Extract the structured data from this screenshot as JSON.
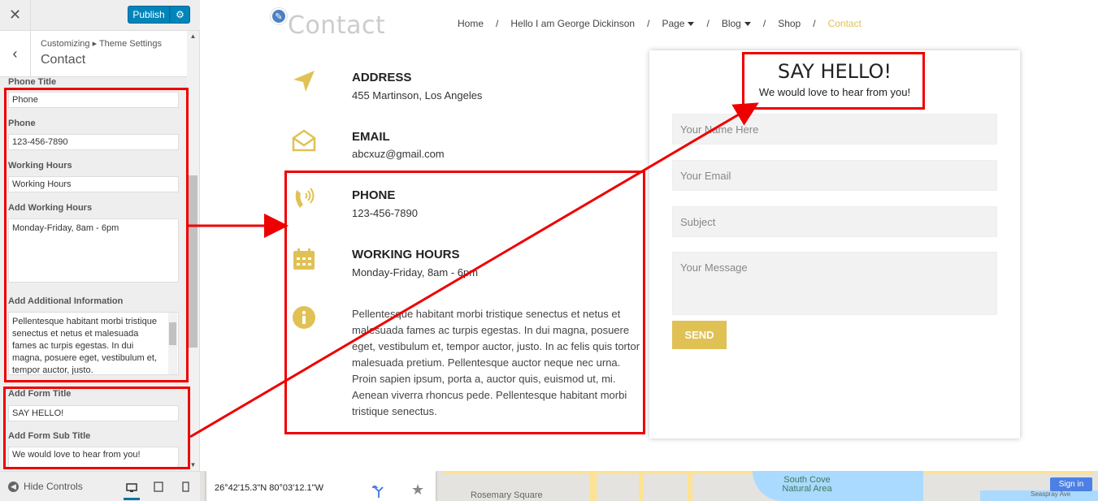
{
  "sidebar": {
    "close_label": "✕",
    "publish_label": "Publish",
    "gear_label": "⚙",
    "back_label": "‹",
    "breadcrumb": "Customizing ▸ Theme Settings",
    "section_title": "Contact",
    "fields": {
      "phone_title_label": "Phone Title",
      "phone_title_value": "Phone",
      "phone_label": "Phone",
      "phone_value": "123-456-7890",
      "working_hours_label": "Working Hours",
      "working_hours_value": "Working Hours",
      "add_working_hours_label": "Add Working Hours",
      "add_working_hours_value": "Monday-Friday, 8am - 6pm",
      "additional_info_label": "Add Additional Information",
      "additional_info_value": "Pellentesque habitant morbi tristique senectus et netus et malesuada fames ac turpis egestas. In dui magna, posuere eget, vestibulum et, tempor auctor, justo.",
      "form_title_label": "Add Form Title",
      "form_title_value": "SAY HELLO!",
      "form_subtitle_label": "Add Form Sub Title",
      "form_subtitle_value": "We would love to hear from you!"
    },
    "footer": {
      "hide_controls": "Hide Controls"
    }
  },
  "preview": {
    "page_title": "Contact",
    "nav": {
      "home": "Home",
      "about": "Hello I am George Dickinson",
      "page": "Page",
      "blog": "Blog",
      "shop": "Shop",
      "contact": "Contact",
      "separator": "/"
    },
    "info": {
      "address_head": "ADDRESS",
      "address_val": "455 Martinson, Los Angeles",
      "email_head": "EMAIL",
      "email_val": "abcxuz@gmail.com",
      "phone_head": "PHONE",
      "phone_val": "123-456-7890",
      "hours_head": "WORKING HOURS",
      "hours_val": "Monday-Friday, 8am - 6pm",
      "additional": "Pellentesque habitant morbi tristique senectus et netus et malesuada fames ac turpis egestas. In dui magna, posuere eget, vestibulum et, tempor auctor, justo. In ac felis quis tortor malesuada pretium. Pellentesque auctor neque nec urna. Proin sapien ipsum, porta a, auctor quis, euismod ut, mi. Aenean viverra rhoncus pede. Pellentesque habitant morbi tristique senectus."
    },
    "form": {
      "title": "SAY HELLO!",
      "subtitle": "We would love to hear from you!",
      "name_placeholder": "Your Name Here",
      "email_placeholder": "Your Email",
      "subject_placeholder": "Subject",
      "message_placeholder": "Your Message",
      "send_label": "SEND"
    },
    "map": {
      "coords": "26°42'15.3\"N 80°03'12.1\"W",
      "label_rosemary": "Rosemary Square",
      "label_southcove": "South Cove Natural Area",
      "label_seaspray": "Seaspray Ave",
      "signin": "Sign in"
    }
  },
  "colors": {
    "accent": "#e0c154",
    "publish": "#0085ba",
    "annotation": "#ee0000"
  }
}
